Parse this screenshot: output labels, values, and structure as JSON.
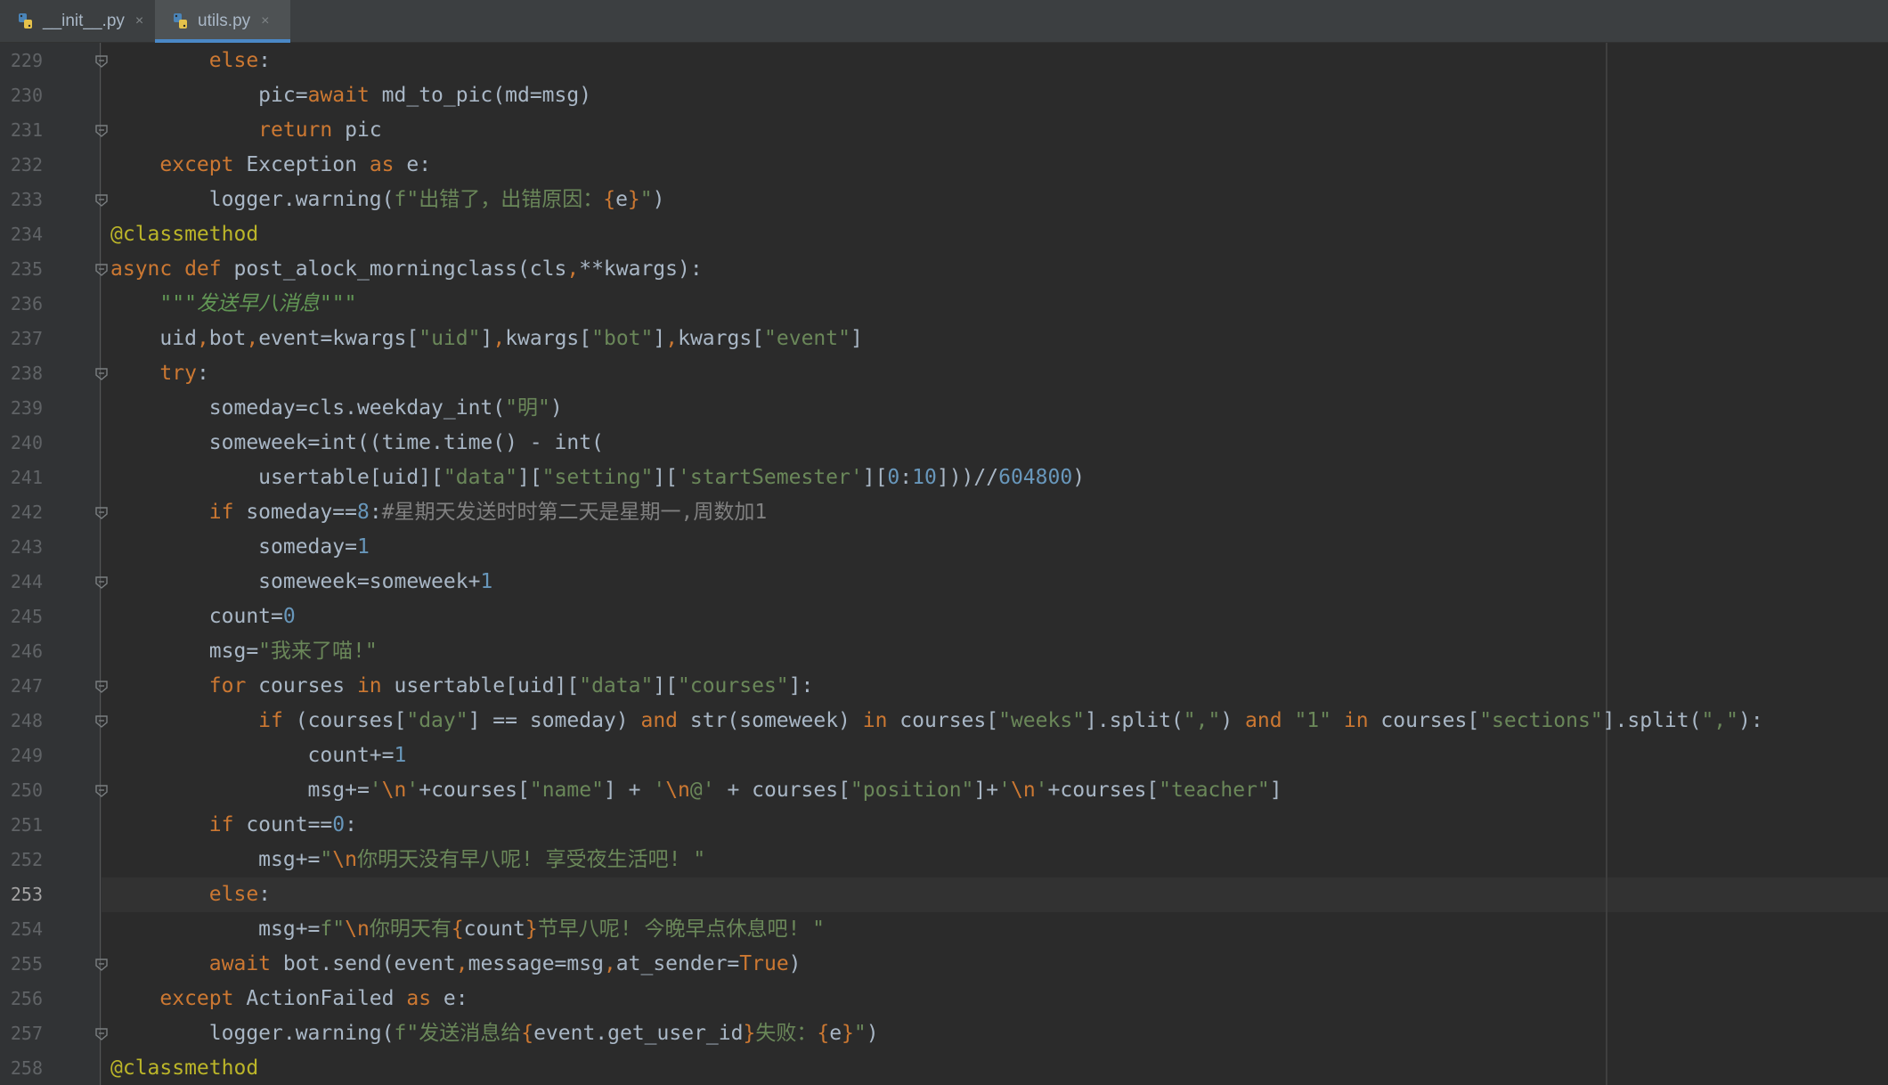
{
  "tabs": [
    {
      "label": "__init__.py",
      "active": false,
      "icon": "python-file-icon"
    },
    {
      "label": "utils.py",
      "active": true,
      "icon": "python-file-icon"
    }
  ],
  "close_glyph": "×",
  "current_line": "253",
  "colors": {
    "background": "#2b2b2b",
    "keyword": "#cc7832",
    "string": "#6a8759",
    "number": "#6897bb",
    "decorator": "#bbb529",
    "comment": "#808080",
    "text": "#a9b7c6",
    "tab_underline": "#4a88c7"
  },
  "code_lines": [
    {
      "num": "229",
      "fold": true,
      "tokens": [
        [
          "        ",
          ""
        ],
        [
          "else",
          "k"
        ],
        [
          ":",
          ""
        ]
      ]
    },
    {
      "num": "230",
      "fold": false,
      "tokens": [
        [
          "            pic=",
          ""
        ],
        [
          "await",
          "k"
        ],
        [
          " md_to_pic(md=msg)",
          ""
        ]
      ]
    },
    {
      "num": "231",
      "fold": true,
      "tokens": [
        [
          "            ",
          ""
        ],
        [
          "return",
          "k"
        ],
        [
          " pic",
          ""
        ]
      ]
    },
    {
      "num": "232",
      "fold": false,
      "tokens": [
        [
          "    ",
          ""
        ],
        [
          "except",
          "k"
        ],
        [
          " Exception ",
          ""
        ],
        [
          "as",
          "k"
        ],
        [
          " e:",
          ""
        ]
      ]
    },
    {
      "num": "233",
      "fold": true,
      "tokens": [
        [
          "        logger.warning(",
          ""
        ],
        [
          "f\"出错了，出错原因：",
          "s"
        ],
        [
          "{",
          "e"
        ],
        [
          "e",
          ""
        ],
        [
          "}",
          "e"
        ],
        [
          "\"",
          "s"
        ],
        [
          ")",
          ""
        ]
      ]
    },
    {
      "num": "234",
      "fold": false,
      "tokens": [
        [
          "@classmethod",
          "d"
        ]
      ]
    },
    {
      "num": "235",
      "fold": true,
      "tokens": [
        [
          "async def",
          "k"
        ],
        [
          " post_alock_morningclass(cls",
          ""
        ],
        [
          ",",
          "k"
        ],
        [
          "**kwargs):",
          ""
        ]
      ]
    },
    {
      "num": "236",
      "fold": false,
      "tokens": [
        [
          "    ",
          ""
        ],
        [
          "\"\"\"发送早八消息\"\"\"",
          "doc"
        ]
      ]
    },
    {
      "num": "237",
      "fold": false,
      "tokens": [
        [
          "    uid",
          ""
        ],
        [
          ",",
          "k"
        ],
        [
          "bot",
          ""
        ],
        [
          ",",
          "k"
        ],
        [
          "event=kwargs[",
          ""
        ],
        [
          "\"uid\"",
          "s"
        ],
        [
          "]",
          ""
        ],
        [
          ",",
          "k"
        ],
        [
          "kwargs[",
          ""
        ],
        [
          "\"bot\"",
          "s"
        ],
        [
          "]",
          ""
        ],
        [
          ",",
          "k"
        ],
        [
          "kwargs[",
          ""
        ],
        [
          "\"event\"",
          "s"
        ],
        [
          "]",
          ""
        ]
      ]
    },
    {
      "num": "238",
      "fold": true,
      "tokens": [
        [
          "    ",
          ""
        ],
        [
          "try",
          "k"
        ],
        [
          ":",
          ""
        ]
      ]
    },
    {
      "num": "239",
      "fold": false,
      "tokens": [
        [
          "        someday=cls.weekday_int(",
          ""
        ],
        [
          "\"明\"",
          "s"
        ],
        [
          ")",
          ""
        ]
      ]
    },
    {
      "num": "240",
      "fold": false,
      "tokens": [
        [
          "        someweek=int((time.time() - int(",
          ""
        ]
      ]
    },
    {
      "num": "241",
      "fold": false,
      "tokens": [
        [
          "            usertable[uid][",
          ""
        ],
        [
          "\"data\"",
          "s"
        ],
        [
          "][",
          ""
        ],
        [
          "\"setting\"",
          "s"
        ],
        [
          "][",
          ""
        ],
        [
          "'startSemester'",
          "s"
        ],
        [
          "][",
          ""
        ],
        [
          "0",
          "n"
        ],
        [
          ":",
          ""
        ],
        [
          "10",
          "n"
        ],
        [
          "]))//",
          ""
        ],
        [
          "604800",
          "n"
        ],
        [
          ")",
          ""
        ]
      ]
    },
    {
      "num": "242",
      "fold": true,
      "tokens": [
        [
          "        ",
          ""
        ],
        [
          "if",
          "k"
        ],
        [
          " someday==",
          ""
        ],
        [
          "8",
          "n"
        ],
        [
          ":",
          ""
        ],
        [
          "#星期天发送时时第二天是星期一,周数加1",
          "c"
        ]
      ]
    },
    {
      "num": "243",
      "fold": false,
      "tokens": [
        [
          "            someday=",
          ""
        ],
        [
          "1",
          "n"
        ]
      ]
    },
    {
      "num": "244",
      "fold": true,
      "tokens": [
        [
          "            someweek=someweek+",
          ""
        ],
        [
          "1",
          "n"
        ]
      ]
    },
    {
      "num": "245",
      "fold": false,
      "tokens": [
        [
          "        count=",
          ""
        ],
        [
          "0",
          "n"
        ]
      ]
    },
    {
      "num": "246",
      "fold": false,
      "tokens": [
        [
          "        msg=",
          ""
        ],
        [
          "\"我来了喵!\"",
          "s"
        ]
      ]
    },
    {
      "num": "247",
      "fold": true,
      "tokens": [
        [
          "        ",
          ""
        ],
        [
          "for",
          "k"
        ],
        [
          " courses ",
          ""
        ],
        [
          "in",
          "k"
        ],
        [
          " usertable[uid][",
          ""
        ],
        [
          "\"data\"",
          "s"
        ],
        [
          "][",
          ""
        ],
        [
          "\"courses\"",
          "s"
        ],
        [
          "]:",
          ""
        ]
      ]
    },
    {
      "num": "248",
      "fold": true,
      "tokens": [
        [
          "            ",
          ""
        ],
        [
          "if",
          "k"
        ],
        [
          " (courses[",
          ""
        ],
        [
          "\"day\"",
          "s"
        ],
        [
          "] == someday) ",
          ""
        ],
        [
          "and",
          "k"
        ],
        [
          " str(someweek) ",
          ""
        ],
        [
          "in",
          "k"
        ],
        [
          " courses[",
          ""
        ],
        [
          "\"weeks\"",
          "s"
        ],
        [
          "].split(",
          ""
        ],
        [
          "\",\"",
          "s"
        ],
        [
          ") ",
          ""
        ],
        [
          "and",
          "k"
        ],
        [
          " ",
          ""
        ],
        [
          "\"1\"",
          "s"
        ],
        [
          " ",
          ""
        ],
        [
          "in",
          "k"
        ],
        [
          " courses[",
          ""
        ],
        [
          "\"sections\"",
          "s"
        ],
        [
          "].split(",
          ""
        ],
        [
          "\",\"",
          "s"
        ],
        [
          "):",
          ""
        ]
      ]
    },
    {
      "num": "249",
      "fold": false,
      "tokens": [
        [
          "                count+=",
          ""
        ],
        [
          "1",
          "n"
        ]
      ]
    },
    {
      "num": "250",
      "fold": true,
      "tokens": [
        [
          "                msg+=",
          ""
        ],
        [
          "'",
          "s"
        ],
        [
          "\\n",
          "e"
        ],
        [
          "'",
          "s"
        ],
        [
          "+courses[",
          ""
        ],
        [
          "\"name\"",
          "s"
        ],
        [
          "] + ",
          ""
        ],
        [
          "'",
          "s"
        ],
        [
          "\\n",
          "e"
        ],
        [
          "@'",
          "s"
        ],
        [
          " + courses[",
          ""
        ],
        [
          "\"position\"",
          "s"
        ],
        [
          "]+",
          ""
        ],
        [
          "'",
          "s"
        ],
        [
          "\\n",
          "e"
        ],
        [
          "'",
          "s"
        ],
        [
          "+courses[",
          ""
        ],
        [
          "\"teacher\"",
          "s"
        ],
        [
          "]",
          ""
        ]
      ]
    },
    {
      "num": "251",
      "fold": false,
      "tokens": [
        [
          "        ",
          ""
        ],
        [
          "if",
          "k"
        ],
        [
          " count==",
          ""
        ],
        [
          "0",
          "n"
        ],
        [
          ":",
          ""
        ]
      ]
    },
    {
      "num": "252",
      "fold": false,
      "tokens": [
        [
          "            msg+=",
          ""
        ],
        [
          "\"",
          "s"
        ],
        [
          "\\n",
          "e"
        ],
        [
          "你明天没有早八呢! 享受夜生活吧! \"",
          "s"
        ]
      ]
    },
    {
      "num": "253",
      "fold": false,
      "tokens": [
        [
          "        ",
          ""
        ],
        [
          "else",
          "k"
        ],
        [
          ":",
          ""
        ]
      ]
    },
    {
      "num": "254",
      "fold": false,
      "tokens": [
        [
          "            msg+=",
          ""
        ],
        [
          "f\"",
          "s"
        ],
        [
          "\\n",
          "e"
        ],
        [
          "你明天有",
          "s"
        ],
        [
          "{",
          "e"
        ],
        [
          "count",
          ""
        ],
        [
          "}",
          "e"
        ],
        [
          "节早八呢! 今晚早点休息吧! \"",
          "s"
        ]
      ]
    },
    {
      "num": "255",
      "fold": true,
      "tokens": [
        [
          "        ",
          ""
        ],
        [
          "await",
          "k"
        ],
        [
          " bot.send(event",
          ""
        ],
        [
          ",",
          "k"
        ],
        [
          "message=msg",
          ""
        ],
        [
          ",",
          "k"
        ],
        [
          "at_sender=",
          ""
        ],
        [
          "True",
          "k"
        ],
        [
          ")",
          ""
        ]
      ]
    },
    {
      "num": "256",
      "fold": false,
      "tokens": [
        [
          "    ",
          ""
        ],
        [
          "except",
          "k"
        ],
        [
          " ActionFailed ",
          ""
        ],
        [
          "as",
          "k"
        ],
        [
          " e:",
          ""
        ]
      ]
    },
    {
      "num": "257",
      "fold": true,
      "tokens": [
        [
          "        logger.warning(",
          ""
        ],
        [
          "f\"发送消息给",
          "s"
        ],
        [
          "{",
          "e"
        ],
        [
          "event.get_user_id",
          ""
        ],
        [
          "}",
          "e"
        ],
        [
          "失败：",
          "s"
        ],
        [
          "{",
          "e"
        ],
        [
          "e",
          ""
        ],
        [
          "}",
          "e"
        ],
        [
          "\"",
          "s"
        ],
        [
          ")",
          ""
        ]
      ]
    },
    {
      "num": "258",
      "fold": false,
      "tokens": [
        [
          "@classmethod",
          "d"
        ]
      ]
    }
  ]
}
